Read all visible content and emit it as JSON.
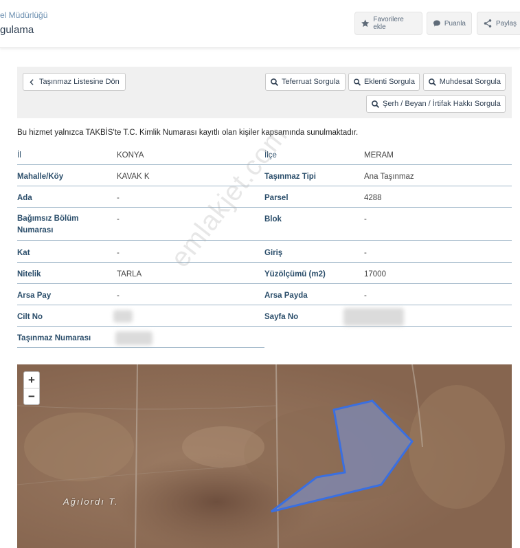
{
  "header": {
    "subtitle": "el Müdürlüğü",
    "title": "gulama",
    "actions": [
      {
        "label": "Favorilere ekle",
        "icon": "star-icon"
      },
      {
        "label": "Puanla",
        "icon": "chat-icon"
      },
      {
        "label": "Paylaş",
        "icon": "share-icon"
      }
    ]
  },
  "toolbar": {
    "back_label": "Taşınmaz Listesine Dön",
    "teferruat": "Teferruat Sorgula",
    "eklenti": "Eklenti Sorgula",
    "muhdesat": "Muhdesat Sorgula",
    "serh": "Şerh / Beyan / İrtifak Hakkı Sorgula"
  },
  "notice": "Bu hizmet yalnızca TAKBİS'te T.C. Kimlik Numarası kayıtlı olan kişiler kapsamında sunulmaktadır.",
  "property": {
    "il_label": "İl",
    "il": "KONYA",
    "ilce_label": "İlçe",
    "ilce": "MERAM",
    "mahalle_label": "Mahalle/Köy",
    "mahalle": "KAVAK K",
    "tip_label": "Taşınmaz Tipi",
    "tip": "Ana Taşınmaz",
    "ada_label": "Ada",
    "ada": "-",
    "parsel_label": "Parsel",
    "parsel": "4288",
    "bolum_label": "Bağımsız Bölüm Numarası",
    "bolum": "-",
    "blok_label": "Blok",
    "blok": "-",
    "kat_label": "Kat",
    "kat": "-",
    "giris_label": "Giriş",
    "giris": "-",
    "nitelik_label": "Nitelik",
    "nitelik": "TARLA",
    "yuzolcum_label": "Yüzölçümü (m2)",
    "yuzolcum": "17000",
    "arsapay_label": "Arsa Pay",
    "arsapay": "-",
    "arsapayda_label": "Arsa Payda",
    "arsapayda": "-",
    "cilt_label": "Cilt No",
    "sayfa_label": "Sayfa No",
    "numara_label": "Taşınmaz Numarası"
  },
  "watermark": "emlakjet.com",
  "map": {
    "zoom_in": "+",
    "zoom_out": "−",
    "place_label": "Ağılordı T.",
    "parcel_color": "#3a6fe0"
  }
}
